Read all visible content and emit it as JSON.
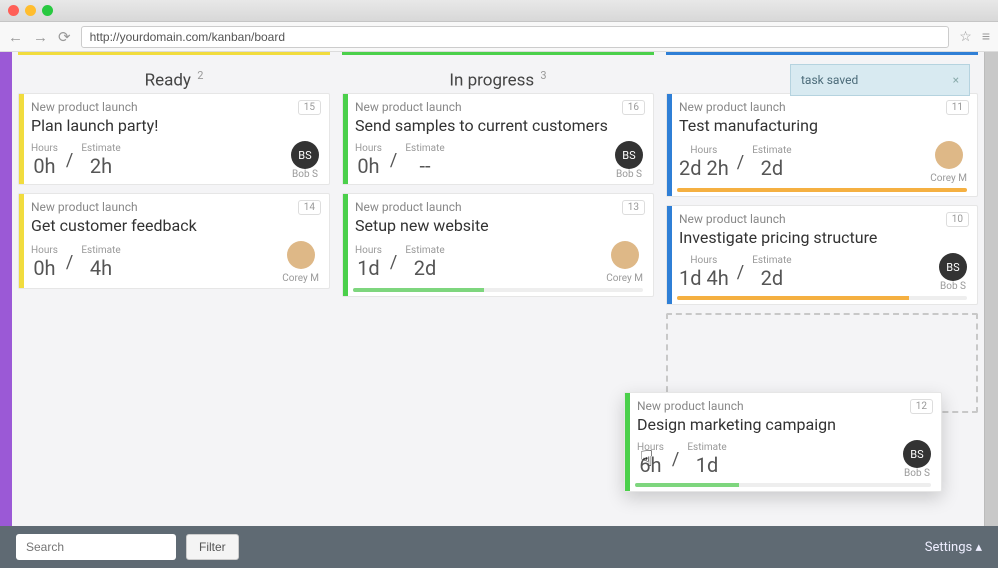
{
  "browser": {
    "url": "http://yourdomain.com/kanban/board"
  },
  "toast": {
    "text": "task saved"
  },
  "columns": [
    {
      "title": "Ready",
      "count": 2
    },
    {
      "title": "In progress",
      "count": 3
    },
    {
      "title": "",
      "count": ""
    }
  ],
  "labels": {
    "hours": "Hours",
    "estimate": "Estimate"
  },
  "cards": {
    "c1": {
      "project": "New product launch",
      "title": "Plan launch party!",
      "num": "15",
      "hours": "0h",
      "estimate": "2h",
      "assignee": "Bob S",
      "avatar": "BS"
    },
    "c2": {
      "project": "New product launch",
      "title": "Get customer feedback",
      "num": "14",
      "hours": "0h",
      "estimate": "4h",
      "assignee": "Corey M",
      "avatar": ""
    },
    "c3": {
      "project": "New product launch",
      "title": "Send samples to current customers",
      "num": "16",
      "hours": "0h",
      "estimate": "--",
      "assignee": "Bob S",
      "avatar": "BS"
    },
    "c4": {
      "project": "New product launch",
      "title": "Setup new website",
      "num": "13",
      "hours": "1d",
      "estimate": "2d",
      "assignee": "Corey M",
      "avatar": ""
    },
    "c5": {
      "project": "New product launch",
      "title": "Test manufacturing",
      "num": "11",
      "hours": "2d 2h",
      "estimate": "2d",
      "assignee": "Corey M",
      "avatar": ""
    },
    "c6": {
      "project": "New product launch",
      "title": "Investigate pricing structure",
      "num": "10",
      "hours": "1d 4h",
      "estimate": "2d",
      "assignee": "Bob S",
      "avatar": "BS"
    },
    "c7": {
      "project": "New product launch",
      "title": "Design marketing campaign",
      "num": "12",
      "hours": "6h",
      "estimate": "1d",
      "assignee": "Bob S",
      "avatar": "BS"
    }
  },
  "footer": {
    "searchPlaceholder": "Search",
    "filter": "Filter",
    "settings": "Settings ▴"
  }
}
